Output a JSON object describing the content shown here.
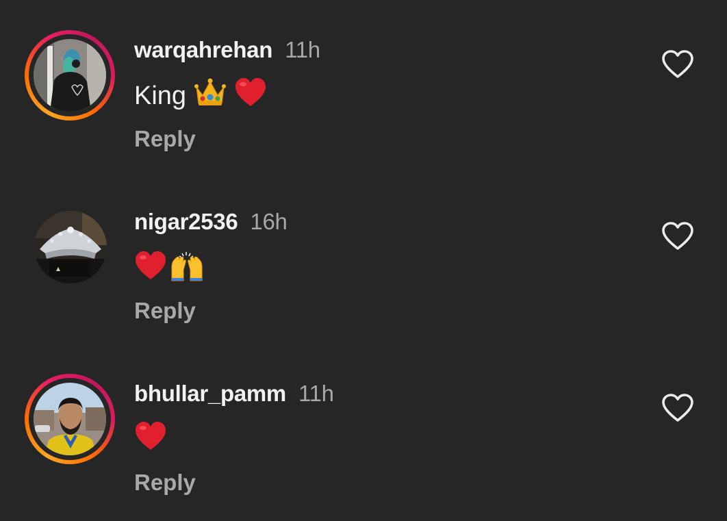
{
  "comments": [
    {
      "username": "warqahrehan",
      "time": "11h",
      "text": "King",
      "emojis": [
        "crown-emoji",
        "red-heart-emoji"
      ],
      "reply_label": "Reply",
      "has_story_ring": true
    },
    {
      "username": "nigar2536",
      "time": "16h",
      "text": "",
      "emojis": [
        "red-heart-emoji",
        "raising-hands-emoji"
      ],
      "reply_label": "Reply",
      "has_story_ring": false
    },
    {
      "username": "bhullar_pamm",
      "time": "11h",
      "text": "",
      "emojis": [
        "red-heart-emoji"
      ],
      "reply_label": "Reply",
      "has_story_ring": true
    }
  ],
  "icons": {
    "like": "heart-outline-icon"
  },
  "colors": {
    "background": "#262626",
    "primary_text": "#f2f2f2",
    "secondary_text": "#a8a8a8",
    "ring_start": "#f9a825",
    "ring_end": "#d81b60",
    "heart_emoji": "#e0202e"
  }
}
